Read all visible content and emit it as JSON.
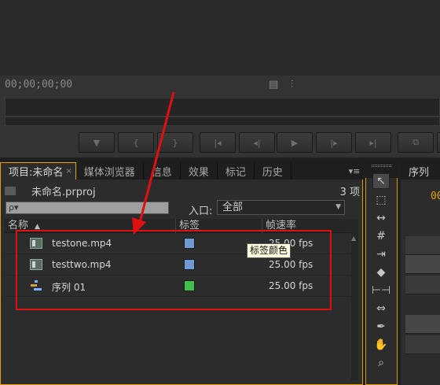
{
  "source_monitor": {
    "timecode": "00;00;00;00"
  },
  "project_panel": {
    "tabs": [
      {
        "label": "项目:未命名",
        "active": true,
        "close": "×"
      },
      {
        "label": "媒体浏览器"
      },
      {
        "label": "信息"
      },
      {
        "label": "效果"
      },
      {
        "label": "标记"
      },
      {
        "label": "历史"
      }
    ],
    "project_file": "未命名.prproj",
    "item_count": "3 项",
    "search_placeholder": "ρ▾",
    "inpoint_label": "入口:",
    "inpoint_value": "全部",
    "columns": {
      "name": "名称",
      "label": "标签",
      "frame_rate": "帧速率"
    },
    "items": [
      {
        "name": "testone.mp4",
        "type": "video-clip",
        "label_color": "#6f9bd4",
        "frame_rate": "25.00 fps",
        "frame_rate_visible": "fps"
      },
      {
        "name": "testtwo.mp4",
        "type": "video-clip",
        "label_color": "#6f9bd4",
        "frame_rate": "25.00 fps"
      },
      {
        "name": "序列 01",
        "type": "sequence",
        "label_color": "#3fc04a",
        "frame_rate": "25.00 fps"
      }
    ],
    "tooltip": "标签颜色"
  },
  "sequence_panel": {
    "tab_label": "序列",
    "timecode": "00"
  },
  "annotation_color": "#e01010",
  "accent_color": "#e4a000"
}
